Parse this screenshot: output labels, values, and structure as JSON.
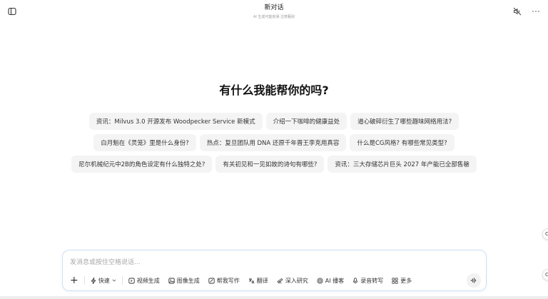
{
  "header": {
    "title": "新对话",
    "subtitle": "AI 生成可能有误 注意甄别"
  },
  "main": {
    "heading": "有什么我能帮你的吗?",
    "suggestions": [
      [
        "资讯：Milvus 3.0 开源发布 Woodpecker Service 新模式",
        "介绍一下咖啡的健康益处",
        "道心破碎衍生了哪些趣味网络用法?"
      ],
      [
        "白月魁在《灵笼》里是什么身份?",
        "热点：复旦团队用 DNA 还原千年晋王李克用真容",
        "什么是CG风格? 有哪些常见类型?"
      ],
      [
        "尼尔机械纪元中2B的角色设定有什么独特之处?",
        "有关初见和一见如故的诗句有哪些?",
        "资讯：三大存储芯片巨头 2027 年产能已全部售罄"
      ]
    ]
  },
  "composer": {
    "placeholder": "发消息或按住空格说话...",
    "value": "",
    "tools": {
      "quick": "快速",
      "video": "视频生成",
      "image": "图像生成",
      "write": "帮我写作",
      "translate": "翻译",
      "research": "深入研究",
      "podcast": "AI 播客",
      "record": "录音转写",
      "more": "更多"
    }
  },
  "icons": {
    "sidebar_toggle": "sidebar-toggle-icon",
    "mute": "speaker-muted-icon",
    "more": "ellipsis-icon",
    "voice": "voice-wave-icon"
  },
  "colors": {
    "composer_border": "#cfe0f5",
    "chip_bg": "#f4f4f5"
  }
}
